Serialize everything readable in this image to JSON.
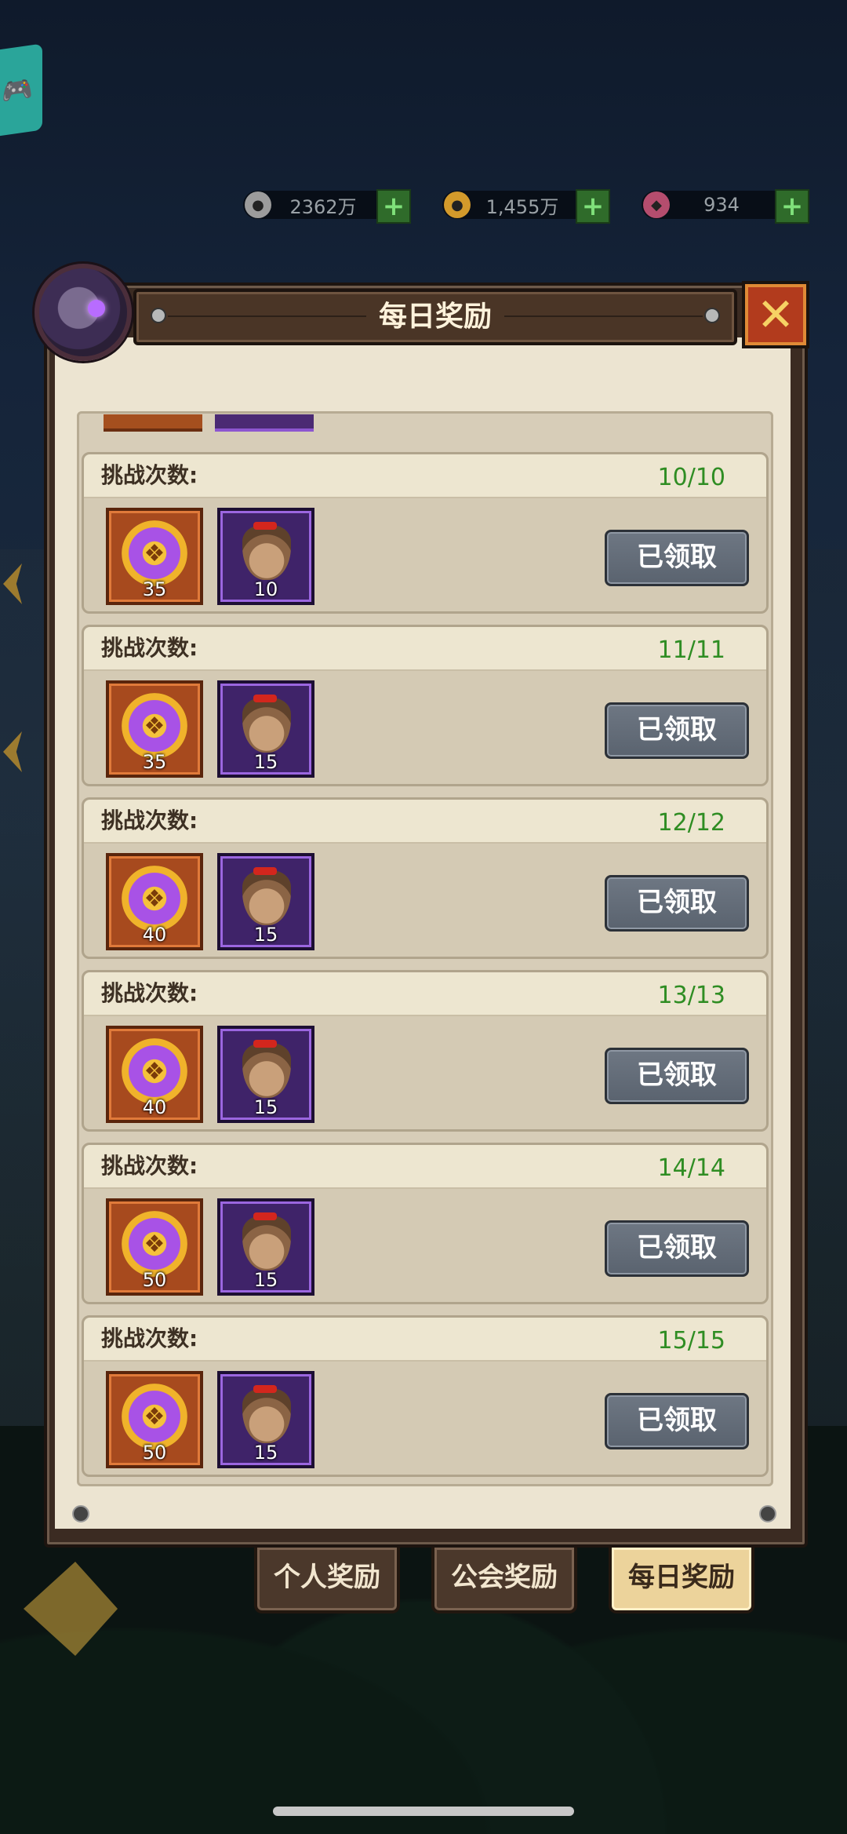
{
  "currencies": [
    {
      "icon": "silver-coin-icon",
      "value": "2362万",
      "color": "#9c9c9c"
    },
    {
      "icon": "gold-coin-icon",
      "value": "1,455万",
      "color": "#d39a2b"
    },
    {
      "icon": "gem-icon",
      "value": "934",
      "color": "#b54d6e"
    }
  ],
  "dialog": {
    "title": "每日奖励",
    "close_icon": "close-icon"
  },
  "rewards": [
    {
      "label": "挑战次数:",
      "progress": "10/10",
      "medal_count": "35",
      "bag_count": "10",
      "button": "已领取"
    },
    {
      "label": "挑战次数:",
      "progress": "11/11",
      "medal_count": "35",
      "bag_count": "15",
      "button": "已领取"
    },
    {
      "label": "挑战次数:",
      "progress": "12/12",
      "medal_count": "40",
      "bag_count": "15",
      "button": "已领取"
    },
    {
      "label": "挑战次数:",
      "progress": "13/13",
      "medal_count": "40",
      "bag_count": "15",
      "button": "已领取"
    },
    {
      "label": "挑战次数:",
      "progress": "14/14",
      "medal_count": "50",
      "bag_count": "15",
      "button": "已领取"
    },
    {
      "label": "挑战次数:",
      "progress": "15/15",
      "medal_count": "50",
      "bag_count": "15",
      "button": "已领取"
    }
  ],
  "tabs": [
    {
      "label": "个人奖励",
      "active": false
    },
    {
      "label": "公会奖励",
      "active": false
    },
    {
      "label": "每日奖励",
      "active": true
    }
  ],
  "colors": {
    "progress_green": "#2f8d23",
    "claimed_button": "#5f6874",
    "active_tab": "#ecd39b"
  }
}
